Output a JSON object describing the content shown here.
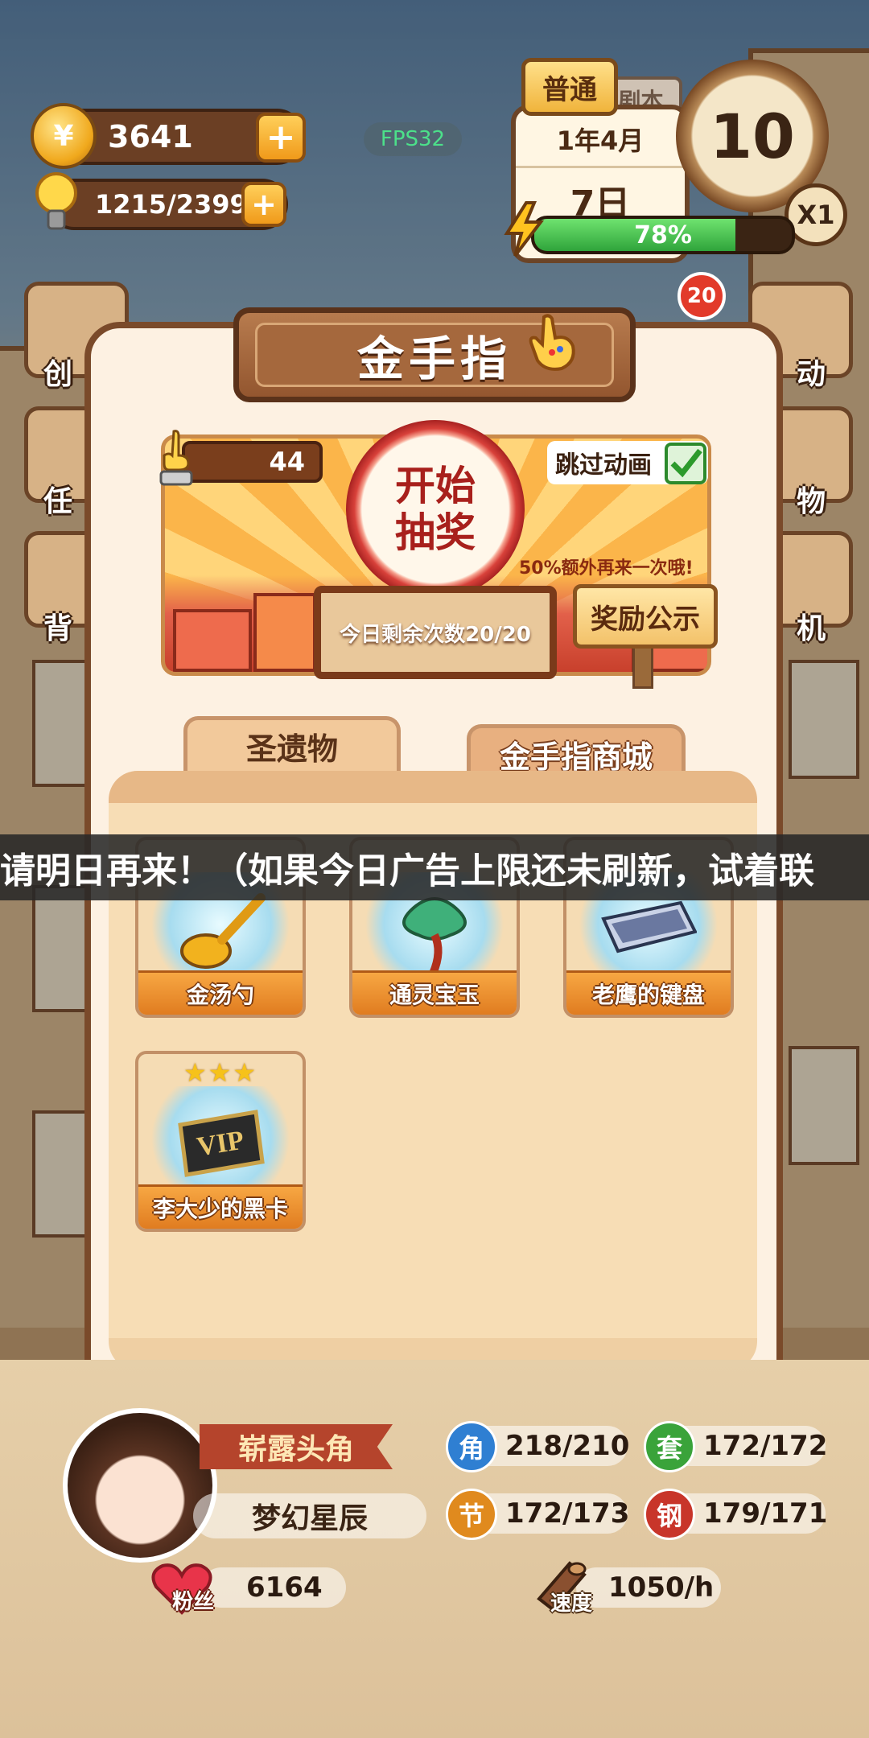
{
  "hud": {
    "coins": "3641",
    "coin_symbol": "¥",
    "energy": "1215/2399",
    "plus": "+",
    "fps": "FPS32"
  },
  "calendar": {
    "mode_tag": "普通",
    "back_tag": "剧本",
    "year_month": "1年4月",
    "day": "7日",
    "clock_value": "10",
    "speed": "X1",
    "energy_percent": "78%",
    "energy_fraction": 0.78
  },
  "side_menu": {
    "left": [
      "创",
      "任",
      "背"
    ],
    "right": [
      "动",
      "物",
      "机"
    ],
    "badge": "20"
  },
  "modal": {
    "title": "金手指",
    "lottery": {
      "count": "44",
      "spin_line1": "开始",
      "spin_line2": "抽奖",
      "skip_label": "跳过动画",
      "bonus": "50%额外再来一次哦!",
      "reward_sign": "奖励公示",
      "remaining": "今日剩余次数20/20"
    },
    "tabs": [
      {
        "label": "圣遗物",
        "active": true
      },
      {
        "label": "金手指商城",
        "active": false
      }
    ],
    "items": [
      {
        "name": "金汤勺",
        "stars": "",
        "icon": "gold-spoon-icon"
      },
      {
        "name": "通灵宝玉",
        "stars": "",
        "icon": "jade-icon"
      },
      {
        "name": "老鹰的键盘",
        "stars": "",
        "icon": "keyboard-icon"
      },
      {
        "name": "李大少的黑卡",
        "stars": "★★★",
        "icon": "vip-card-icon"
      }
    ]
  },
  "toast": "请明日再来！（如果今日广告上限还未刷新，试着联",
  "profile": {
    "rank": "崭露头角",
    "name": "梦幻星辰",
    "stats": [
      {
        "icon_text": "角",
        "value": "218/210",
        "color": "#2f7fd2"
      },
      {
        "icon_text": "套",
        "value": "172/172",
        "color": "#3aa33a"
      },
      {
        "icon_text": "节",
        "value": "172/173",
        "color": "#e08a1e"
      },
      {
        "icon_text": "钢",
        "value": "179/171",
        "color": "#c8352a"
      }
    ],
    "fans_label": "粉丝",
    "fans": "6164",
    "speed_label": "速度",
    "speed": "1050/h"
  }
}
